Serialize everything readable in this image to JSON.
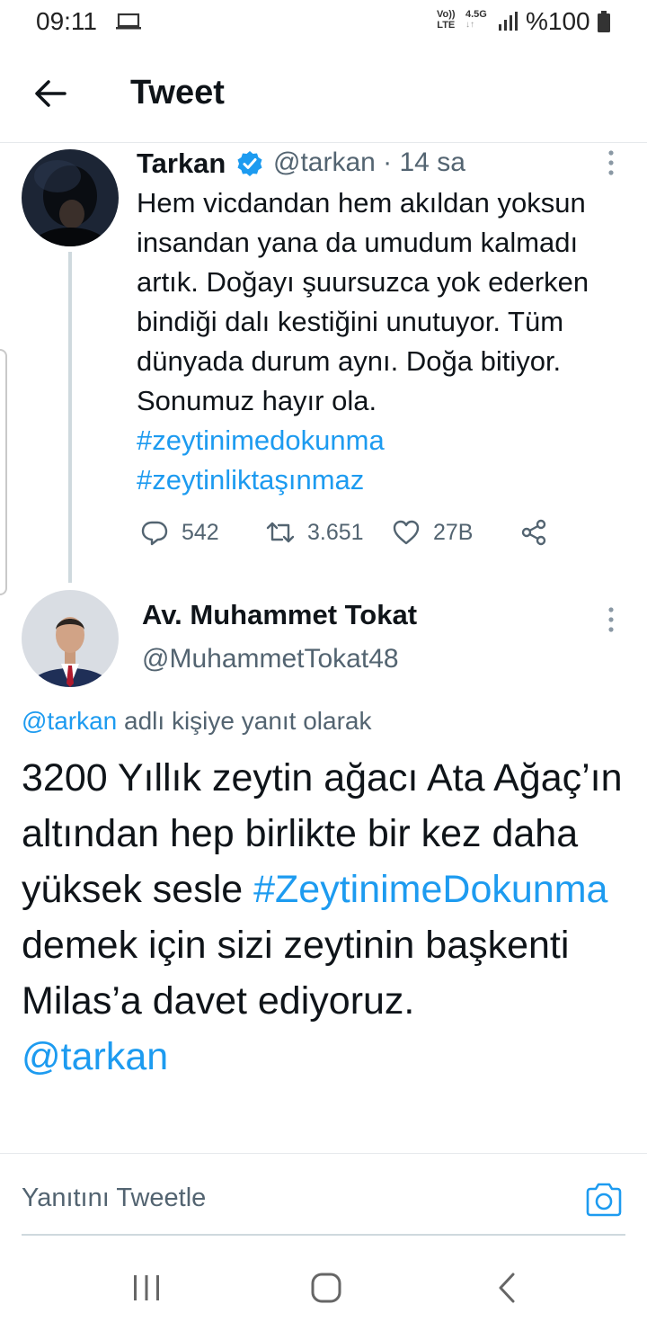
{
  "status_bar": {
    "time": "09:11",
    "network_top": "Vo))",
    "network_bottom": "LTE",
    "generation": "4.5G",
    "battery_text": "%100"
  },
  "header": {
    "title": "Tweet"
  },
  "tweet1": {
    "name": "Tarkan",
    "handle_time": "@tarkan · 14 sa",
    "text": "Hem vicdandan hem akıldan yoksun insandan yana da umudum kalmadı artık. Doğayı şuursuzca yok ederken bindiği dalı kestiğini unutuyor. Tüm dünyada durum aynı. Doğa bitiyor. Sonumuz hayır ola.",
    "hashtag1": "#zeytinimedokunma",
    "hashtag2": "#zeytinliktaşınmaz",
    "replies": "542",
    "retweets": "3.651",
    "likes": "27B"
  },
  "tweet2": {
    "name": "Av. Muhammet Tokat",
    "handle": "@MuhammetTokat48",
    "reply_mention": "@tarkan",
    "reply_suffix": " adlı kişiye yanıt olarak",
    "text_part1": "3200 Yıllık zeytin ağacı Ata Ağaç’ın altından hep birlikte bir kez daha yüksek sesle ",
    "text_hashtag": "#ZeytinimeDokunma",
    "text_part2": " demek için sizi zeytinin başkenti Milas’a davet ediyoruz.",
    "text_mention": "@tarkan"
  },
  "reply_bar": {
    "placeholder": "Yanıtını Tweetle"
  },
  "colors": {
    "link": "#1d9bf0",
    "secondary_text": "#536471",
    "primary_text": "#0f1419"
  },
  "icons": [
    "back-arrow-icon",
    "verified-badge-icon",
    "more-options-icon",
    "reply-icon",
    "retweet-icon",
    "like-icon",
    "share-icon",
    "camera-icon",
    "recent-apps-icon",
    "home-icon",
    "nav-back-icon"
  ]
}
